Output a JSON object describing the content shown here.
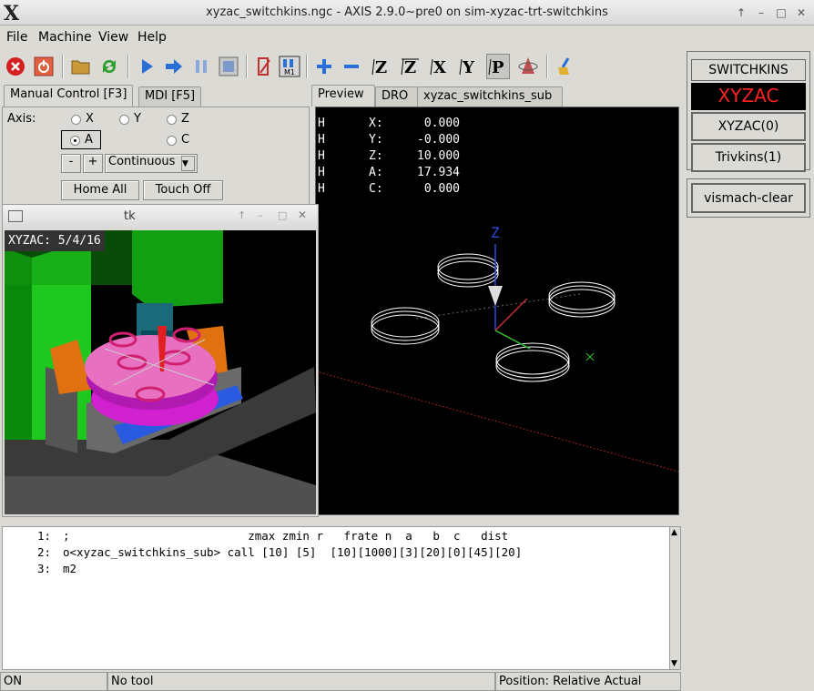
{
  "window": {
    "title": "xyzac_switchkins.ngc - AXIS 2.9.0~pre0 on sim-xyzac-trt-switchkins",
    "logo": "X"
  },
  "menu": [
    "File",
    "Machine",
    "View",
    "Help"
  ],
  "tabs_left": {
    "manual": "Manual Control [F3]",
    "mdi": "MDI [F5]"
  },
  "axis": {
    "label": "Axis:",
    "options": [
      "X",
      "Y",
      "Z",
      "A",
      "C"
    ],
    "selected": "A"
  },
  "jog": {
    "minus": "-",
    "plus": "+",
    "mode": "Continuous"
  },
  "buttons": {
    "home_all": "Home All",
    "touch_off": "Touch Off"
  },
  "tk_window": {
    "title": "tk",
    "overlay_label": "XYZAC: 5/4/16"
  },
  "tabs_right": {
    "preview": "Preview",
    "dro": "DRO",
    "sub": "xyzac_switchkins_sub"
  },
  "dro": [
    {
      "flag": "H",
      "axis": "X:",
      "value": "0.000"
    },
    {
      "flag": "H",
      "axis": "Y:",
      "value": "-0.000"
    },
    {
      "flag": "H",
      "axis": "Z:",
      "value": "10.000"
    },
    {
      "flag": "H",
      "axis": "A:",
      "value": "17.934"
    },
    {
      "flag": "H",
      "axis": "C:",
      "value": "0.000"
    }
  ],
  "preview_axis_label": "Z",
  "code_lines": [
    {
      "num": "1:",
      "text": ";                          zmax zmin r   frate n  a   b  c   dist"
    },
    {
      "num": "2:",
      "text": "o<xyzac_switchkins_sub> call [10] [5]  [10][1000][3][20][0][45][20]"
    },
    {
      "num": "3:",
      "text": "m2"
    }
  ],
  "switchkins": {
    "header": "SWITCHKINS",
    "current": "XYZAC",
    "btn1": "XYZAC(0)",
    "btn2": "Trivkins(1)",
    "vismach": "vismach-clear"
  },
  "status": {
    "state": "ON",
    "tool": "No tool",
    "position": "Position: Relative Actual"
  },
  "colors": {
    "estop": "#d42020",
    "accent_blue": "#2a6fd6",
    "current_kins_text": "#ff2020"
  }
}
